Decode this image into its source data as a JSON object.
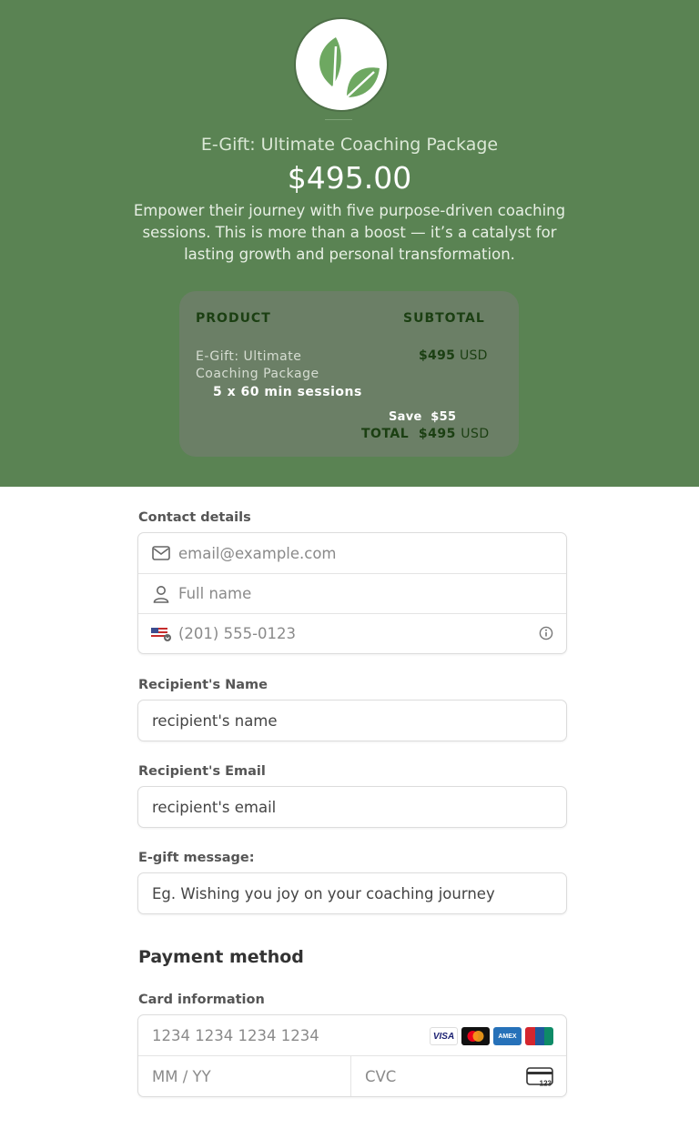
{
  "header": {
    "logo_icon": "leaf-icon",
    "product_title": "E-Gift: Ultimate Coaching Package",
    "price": "$495.00",
    "description": "Empower their journey with five purpose-driven coaching sessions. This is more than a boost — it’s a catalyst for lasting growth and personal transformation."
  },
  "summary": {
    "col_product": "PRODUCT",
    "col_subtotal": "SUBTOTAL",
    "item_name": "E-Gift: Ultimate Coaching Package",
    "item_detail": "5 x 60 min sessions",
    "item_amount": "$495",
    "item_currency": "USD",
    "save_label": "Save",
    "save_amount": "$55",
    "total_label": "TOTAL",
    "total_amount": "$495",
    "total_currency": "USD"
  },
  "contact": {
    "label": "Contact details",
    "email_placeholder": "email@example.com",
    "name_placeholder": "Full name",
    "phone_placeholder": "(201) 555-0123"
  },
  "recipient_name": {
    "label": "Recipient's Name",
    "value": "recipient's name"
  },
  "recipient_email": {
    "label": "Recipient's Email",
    "value": "recipient's email"
  },
  "gift_message": {
    "label": "E-gift message:",
    "value": "Eg. Wishing you joy on your coaching journey"
  },
  "payment": {
    "title": "Payment method",
    "card_label": "Card information",
    "card_number_placeholder": "1234 1234 1234 1234",
    "expiry_placeholder": "MM / YY",
    "cvc_placeholder": "CVC",
    "brands": [
      "VISA",
      "Mastercard",
      "AMEX",
      "UnionPay"
    ],
    "cvc_icon_text": "123"
  },
  "colors": {
    "header_bg": "#5a8353",
    "summary_bg": "#6b7f66",
    "accent_dark_green": "#1b3f12"
  }
}
